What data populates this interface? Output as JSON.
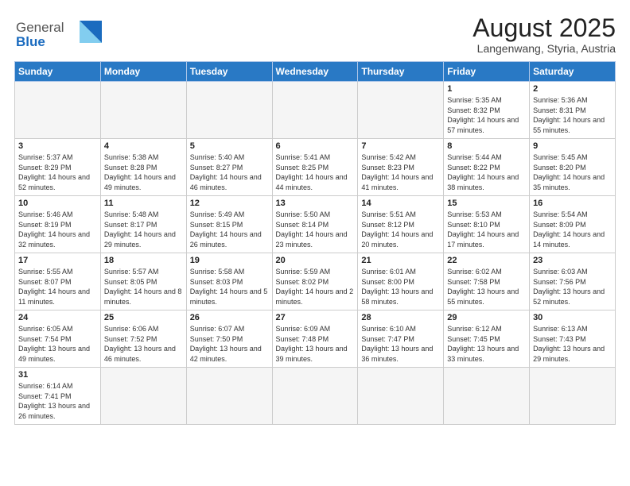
{
  "header": {
    "logo_general": "General",
    "logo_blue": "Blue",
    "month_year": "August 2025",
    "location": "Langenwang, Styria, Austria"
  },
  "weekdays": [
    "Sunday",
    "Monday",
    "Tuesday",
    "Wednesday",
    "Thursday",
    "Friday",
    "Saturday"
  ],
  "weeks": [
    [
      {
        "day": "",
        "info": ""
      },
      {
        "day": "",
        "info": ""
      },
      {
        "day": "",
        "info": ""
      },
      {
        "day": "",
        "info": ""
      },
      {
        "day": "",
        "info": ""
      },
      {
        "day": "1",
        "info": "Sunrise: 5:35 AM\nSunset: 8:32 PM\nDaylight: 14 hours and 57 minutes."
      },
      {
        "day": "2",
        "info": "Sunrise: 5:36 AM\nSunset: 8:31 PM\nDaylight: 14 hours and 55 minutes."
      }
    ],
    [
      {
        "day": "3",
        "info": "Sunrise: 5:37 AM\nSunset: 8:29 PM\nDaylight: 14 hours and 52 minutes."
      },
      {
        "day": "4",
        "info": "Sunrise: 5:38 AM\nSunset: 8:28 PM\nDaylight: 14 hours and 49 minutes."
      },
      {
        "day": "5",
        "info": "Sunrise: 5:40 AM\nSunset: 8:27 PM\nDaylight: 14 hours and 46 minutes."
      },
      {
        "day": "6",
        "info": "Sunrise: 5:41 AM\nSunset: 8:25 PM\nDaylight: 14 hours and 44 minutes."
      },
      {
        "day": "7",
        "info": "Sunrise: 5:42 AM\nSunset: 8:23 PM\nDaylight: 14 hours and 41 minutes."
      },
      {
        "day": "8",
        "info": "Sunrise: 5:44 AM\nSunset: 8:22 PM\nDaylight: 14 hours and 38 minutes."
      },
      {
        "day": "9",
        "info": "Sunrise: 5:45 AM\nSunset: 8:20 PM\nDaylight: 14 hours and 35 minutes."
      }
    ],
    [
      {
        "day": "10",
        "info": "Sunrise: 5:46 AM\nSunset: 8:19 PM\nDaylight: 14 hours and 32 minutes."
      },
      {
        "day": "11",
        "info": "Sunrise: 5:48 AM\nSunset: 8:17 PM\nDaylight: 14 hours and 29 minutes."
      },
      {
        "day": "12",
        "info": "Sunrise: 5:49 AM\nSunset: 8:15 PM\nDaylight: 14 hours and 26 minutes."
      },
      {
        "day": "13",
        "info": "Sunrise: 5:50 AM\nSunset: 8:14 PM\nDaylight: 14 hours and 23 minutes."
      },
      {
        "day": "14",
        "info": "Sunrise: 5:51 AM\nSunset: 8:12 PM\nDaylight: 14 hours and 20 minutes."
      },
      {
        "day": "15",
        "info": "Sunrise: 5:53 AM\nSunset: 8:10 PM\nDaylight: 14 hours and 17 minutes."
      },
      {
        "day": "16",
        "info": "Sunrise: 5:54 AM\nSunset: 8:09 PM\nDaylight: 14 hours and 14 minutes."
      }
    ],
    [
      {
        "day": "17",
        "info": "Sunrise: 5:55 AM\nSunset: 8:07 PM\nDaylight: 14 hours and 11 minutes."
      },
      {
        "day": "18",
        "info": "Sunrise: 5:57 AM\nSunset: 8:05 PM\nDaylight: 14 hours and 8 minutes."
      },
      {
        "day": "19",
        "info": "Sunrise: 5:58 AM\nSunset: 8:03 PM\nDaylight: 14 hours and 5 minutes."
      },
      {
        "day": "20",
        "info": "Sunrise: 5:59 AM\nSunset: 8:02 PM\nDaylight: 14 hours and 2 minutes."
      },
      {
        "day": "21",
        "info": "Sunrise: 6:01 AM\nSunset: 8:00 PM\nDaylight: 13 hours and 58 minutes."
      },
      {
        "day": "22",
        "info": "Sunrise: 6:02 AM\nSunset: 7:58 PM\nDaylight: 13 hours and 55 minutes."
      },
      {
        "day": "23",
        "info": "Sunrise: 6:03 AM\nSunset: 7:56 PM\nDaylight: 13 hours and 52 minutes."
      }
    ],
    [
      {
        "day": "24",
        "info": "Sunrise: 6:05 AM\nSunset: 7:54 PM\nDaylight: 13 hours and 49 minutes."
      },
      {
        "day": "25",
        "info": "Sunrise: 6:06 AM\nSunset: 7:52 PM\nDaylight: 13 hours and 46 minutes."
      },
      {
        "day": "26",
        "info": "Sunrise: 6:07 AM\nSunset: 7:50 PM\nDaylight: 13 hours and 42 minutes."
      },
      {
        "day": "27",
        "info": "Sunrise: 6:09 AM\nSunset: 7:48 PM\nDaylight: 13 hours and 39 minutes."
      },
      {
        "day": "28",
        "info": "Sunrise: 6:10 AM\nSunset: 7:47 PM\nDaylight: 13 hours and 36 minutes."
      },
      {
        "day": "29",
        "info": "Sunrise: 6:12 AM\nSunset: 7:45 PM\nDaylight: 13 hours and 33 minutes."
      },
      {
        "day": "30",
        "info": "Sunrise: 6:13 AM\nSunset: 7:43 PM\nDaylight: 13 hours and 29 minutes."
      }
    ],
    [
      {
        "day": "31",
        "info": "Sunrise: 6:14 AM\nSunset: 7:41 PM\nDaylight: 13 hours and 26 minutes."
      },
      {
        "day": "",
        "info": ""
      },
      {
        "day": "",
        "info": ""
      },
      {
        "day": "",
        "info": ""
      },
      {
        "day": "",
        "info": ""
      },
      {
        "day": "",
        "info": ""
      },
      {
        "day": "",
        "info": ""
      }
    ]
  ]
}
